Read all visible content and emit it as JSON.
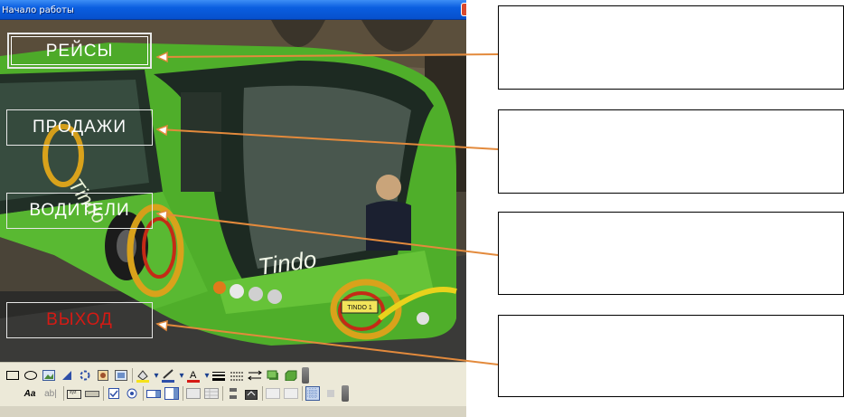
{
  "window": {
    "title": "Начало работы"
  },
  "form": {
    "buttons": {
      "flights": "РЕЙСЫ",
      "sales": "ПРОДАЖИ",
      "drivers": "ВОДИТЕЛИ",
      "exit": "ВЫХОД"
    },
    "photo_text": {
      "side_brand": "Tindo",
      "front_brand": "Tindo",
      "plate": "TINDO 1"
    }
  },
  "toolbar": {
    "row1_icons": [
      "rectangle-icon",
      "ellipse-icon",
      "image-icon",
      "hyperlink-icon",
      "rotate-icon",
      "photo-icon",
      "picture-frame-icon",
      "fill-color-icon",
      "line-color-icon",
      "font-color-icon",
      "line-width-icon",
      "line-style-icon",
      "arrow-style-icon",
      "shadow-icon",
      "3d-icon"
    ],
    "row2_labels": {
      "style_label": "Aa",
      "textbox_label": "ab|"
    }
  },
  "colors": {
    "arrow": "#e38a3c",
    "titlebar": "#0a5ee0",
    "exit_text": "#d51a14",
    "bus_green": "#4fae2a"
  },
  "callouts": [
    "",
    "",
    "",
    ""
  ]
}
